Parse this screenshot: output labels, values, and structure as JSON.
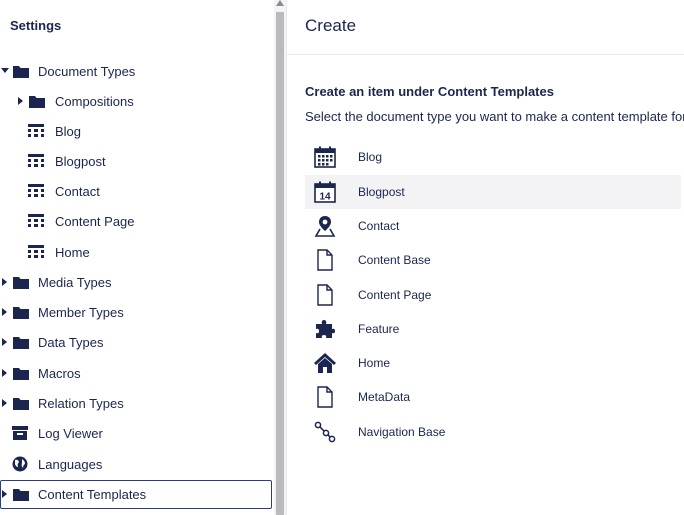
{
  "tree": {
    "title": "Settings",
    "items": [
      {
        "label": "Document Types",
        "icon": "folder-icon",
        "caret": "down"
      },
      {
        "label": "Compositions",
        "icon": "folder-icon",
        "caret": "right"
      },
      {
        "label": "Blog",
        "icon": "document-type-icon",
        "caret": "none"
      },
      {
        "label": "Blogpost",
        "icon": "document-type-icon",
        "caret": "none"
      },
      {
        "label": "Contact",
        "icon": "document-type-icon",
        "caret": "none"
      },
      {
        "label": "Content Page",
        "icon": "document-type-icon",
        "caret": "none"
      },
      {
        "label": "Home",
        "icon": "document-type-icon",
        "caret": "none"
      },
      {
        "label": "Media Types",
        "icon": "folder-icon",
        "caret": "right"
      },
      {
        "label": "Member Types",
        "icon": "folder-icon",
        "caret": "right"
      },
      {
        "label": "Data Types",
        "icon": "folder-icon",
        "caret": "right"
      },
      {
        "label": "Macros",
        "icon": "folder-icon",
        "caret": "right"
      },
      {
        "label": "Relation Types",
        "icon": "folder-icon",
        "caret": "right"
      },
      {
        "label": "Log Viewer",
        "icon": "box-icon",
        "caret": "none"
      },
      {
        "label": "Languages",
        "icon": "globe-icon",
        "caret": "none"
      },
      {
        "label": "Content Templates",
        "icon": "folder-icon",
        "caret": "right"
      }
    ]
  },
  "panel": {
    "title": "Create",
    "heading": "Create an item under Content Templates",
    "description": "Select the document type you want to make a content template for",
    "types": [
      {
        "label": "Blog",
        "icon": "calendar-icon"
      },
      {
        "label": "Blogpost",
        "icon": "calendar-14-icon"
      },
      {
        "label": "Contact",
        "icon": "map-pin-icon"
      },
      {
        "label": "Content Base",
        "icon": "document-icon"
      },
      {
        "label": "Content Page",
        "icon": "document-icon"
      },
      {
        "label": "Feature",
        "icon": "puzzle-icon"
      },
      {
        "label": "Home",
        "icon": "home-icon"
      },
      {
        "label": "MetaData",
        "icon": "document-icon"
      },
      {
        "label": "Navigation Base",
        "icon": "nodes-icon"
      }
    ],
    "calendar_day": "14"
  },
  "colors": {
    "text": "#1b264f",
    "selected_border": "#2a3a8c",
    "hover_bg": "#f3f3f5",
    "scroll_thumb": "#b9b9be"
  }
}
